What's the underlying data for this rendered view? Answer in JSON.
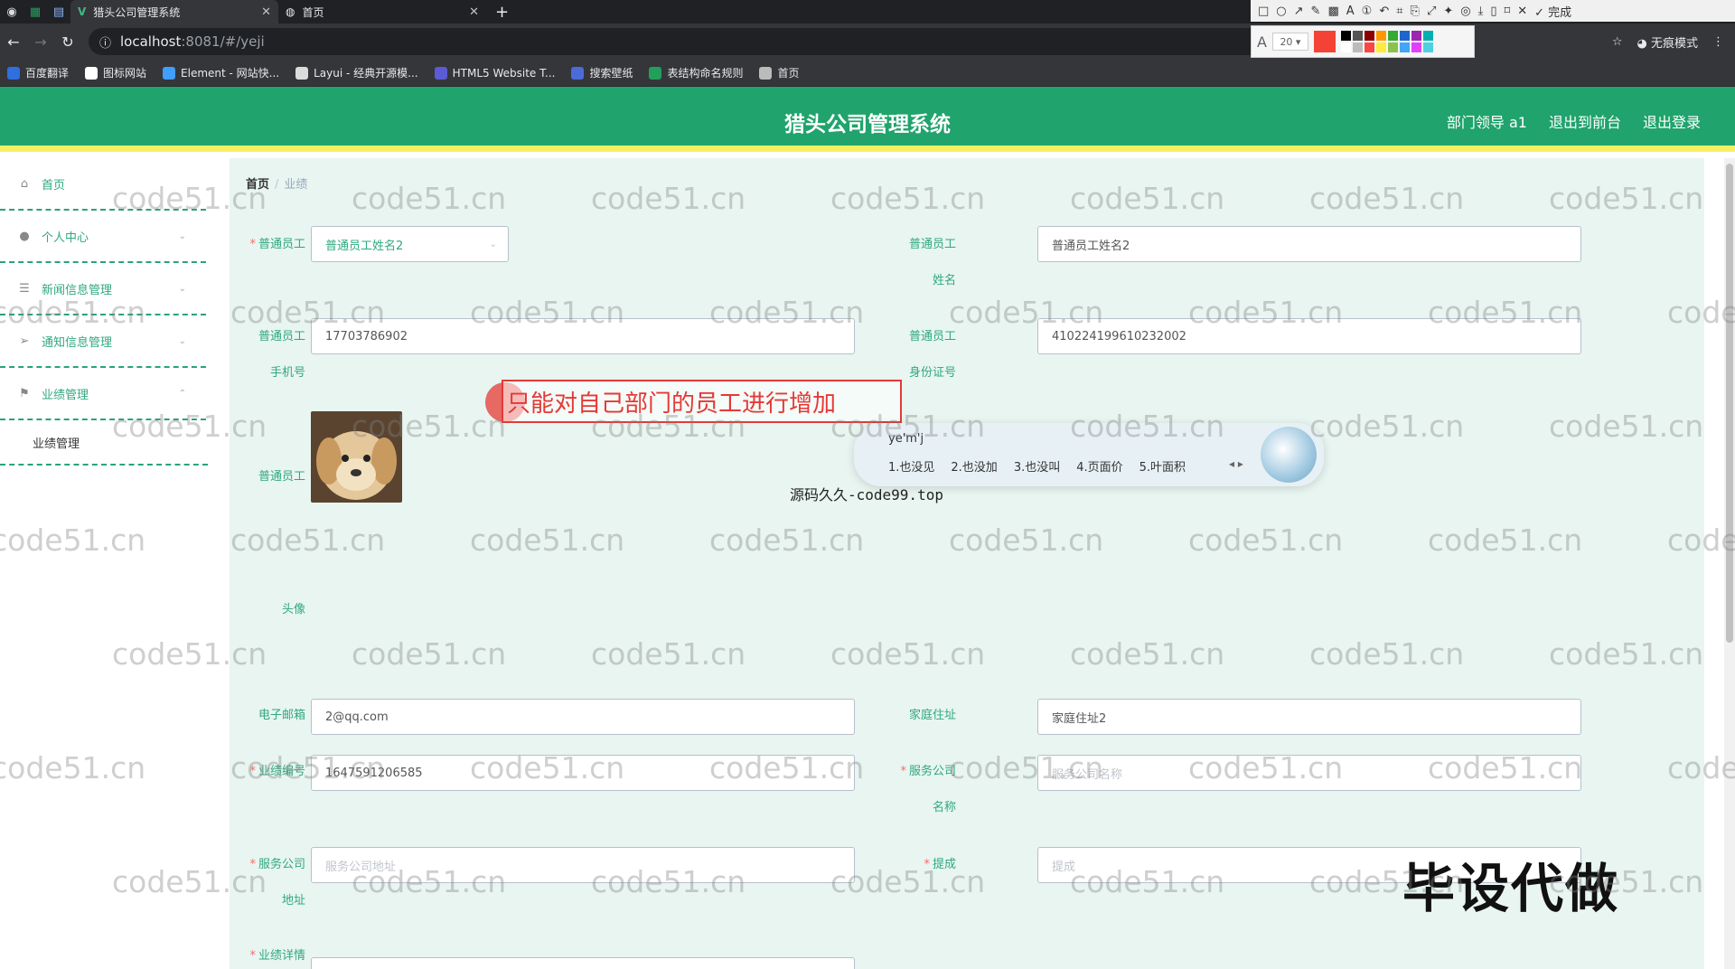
{
  "browser": {
    "tabs": [
      {
        "title": "猎头公司管理系统",
        "active": true
      },
      {
        "title": "首页",
        "active": false
      }
    ],
    "url_host": "localhost",
    "url_path": ":8081/#/yeji",
    "bookmarks": [
      {
        "label": "百度翻译",
        "color": "#2f6fde"
      },
      {
        "label": "图标网站",
        "color": "#ffffff"
      },
      {
        "label": "Element - 网站快...",
        "color": "#409eff"
      },
      {
        "label": "Layui - 经典开源模...",
        "color": "#dcdcdc"
      },
      {
        "label": "HTML5 Website T...",
        "color": "#5b5bd6"
      },
      {
        "label": "搜索壁纸",
        "color": "#4b6cd6"
      },
      {
        "label": "表结构命名规则",
        "color": "#22a05b"
      },
      {
        "label": "首页",
        "color": "#bbbbbb"
      }
    ],
    "incognito_label": "无痕模式"
  },
  "snip_tool": {
    "done_label": "完成",
    "font_size": "20",
    "current_color": "#f44336",
    "swatches": [
      "#000000",
      "#555555",
      "#8b0000",
      "#ff9800",
      "#33aa33",
      "#1e66cc",
      "#9c27b0",
      "#00b0b0",
      "#ffffff",
      "#bbbbbb",
      "#ff4444",
      "#ffeb3b",
      "#8bc34a",
      "#42a5f5",
      "#e040fb",
      "#4dd0e1"
    ]
  },
  "header": {
    "title": "猎头公司管理系统",
    "user_label": "部门领导 a1",
    "front_label": "退出到前台",
    "logout_label": "退出登录"
  },
  "sidebar": {
    "items": [
      {
        "label": "首页",
        "icon": "home-icon"
      },
      {
        "label": "个人中心",
        "icon": "user-icon"
      },
      {
        "label": "新闻信息管理",
        "icon": "list-icon"
      },
      {
        "label": "通知信息管理",
        "icon": "send-icon"
      },
      {
        "label": "业绩管理",
        "icon": "flag-icon"
      }
    ],
    "sub_item": "业绩管理"
  },
  "breadcrumb": {
    "home": "首页",
    "current": "业绩"
  },
  "form": {
    "employee_label": "普通员工",
    "employee_select": "普通员工姓名2",
    "name_label_1": "普通员工",
    "name_label_2": "姓名",
    "name_value": "普通员工姓名2",
    "phone_label_1": "普通员工",
    "phone_label_2": "手机号",
    "phone_value": "17703786902",
    "id_label_1": "普通员工",
    "id_label_2": "身份证号",
    "id_value": "410224199610232002",
    "avatar_label_1": "普通员工",
    "avatar_label_2": "头像",
    "email_label": "电子邮箱",
    "email_value": "2@qq.com",
    "address_label": "家庭住址",
    "address_value": "家庭住址2",
    "perf_no_label": "业绩编号",
    "perf_no_value": "1647591206585",
    "company_name_label_1": "服务公司",
    "company_name_label_2": "名称",
    "company_name_placeholder": "服务公司名称",
    "company_addr_label_1": "服务公司",
    "company_addr_label_2": "地址",
    "company_addr_placeholder": "服务公司地址",
    "commission_label": "提成",
    "commission_placeholder": "提成",
    "detail_label": "业绩详情"
  },
  "overlays": {
    "annotation": "只能对自己部门的员工进行增加",
    "ime_input": "ye'm'j",
    "ime_candidates": [
      "1.也没见",
      "2.也没加",
      "3.也没叫",
      "4.页面价",
      "5.叶面积"
    ],
    "source_text": "源码久久-code99.top",
    "stamp": "毕设代做",
    "watermark": "code51.cn"
  }
}
